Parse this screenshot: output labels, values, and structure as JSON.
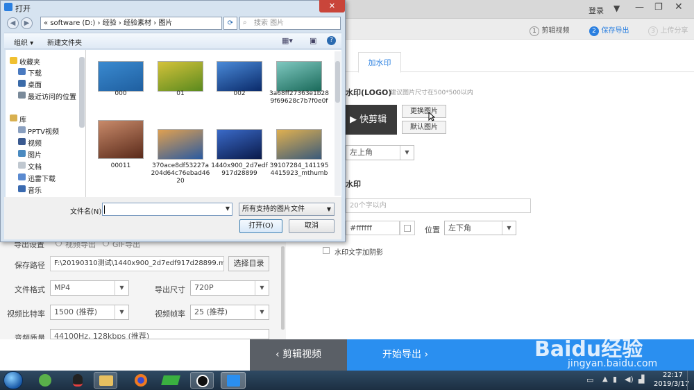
{
  "app": {
    "login": "登录",
    "steps": [
      {
        "num": "1",
        "label": "剪辑视频"
      },
      {
        "num": "2",
        "label": "保存导出"
      },
      {
        "num": "3",
        "label": "上传分享"
      }
    ],
    "tabs": {
      "watermark": "加水印"
    },
    "logo_section": {
      "title": "水印(LOGO)",
      "hint": "建议图片尺寸在500*500以内",
      "logo_text": "快剪辑",
      "change_btn": "更换图片",
      "default_btn": "默认图片",
      "position_value": "左上角"
    },
    "text_section": {
      "title": "水印",
      "placeholder": "20个字以内",
      "color_value": "#ffffff",
      "position_label": "位置",
      "position_value": "左下角",
      "shadow_label": "水印文字加阴影"
    },
    "export": {
      "settings_label": "导出设置",
      "mode_normal": "视频导出",
      "mode_gif": "GIF导出",
      "save_path_label": "保存路径",
      "save_path_value": "F:\\20190310测试\\1440x900_2d7edf917d28899.mp4",
      "choose_dir_btn": "选择目录",
      "format_label": "文件格式",
      "format_value": "MP4",
      "size_label": "导出尺寸",
      "size_value": "720P",
      "bitrate_label": "视频比特率",
      "bitrate_value": "1500 (推荐)",
      "fps_label": "视频帧率",
      "fps_value": "25 (推荐)",
      "audio_label": "音频质量",
      "audio_value": "44100Hz, 128kbps (推荐)"
    },
    "bottom": {
      "back_btn": "‹  剪辑视频",
      "start_btn": "开始导出  ›"
    }
  },
  "dialog": {
    "title": "打开",
    "breadcrumb": [
      "«",
      "software (D:)",
      "›",
      "经验",
      "›",
      "经验素材",
      "›",
      "图片"
    ],
    "search_placeholder": "搜索 图片",
    "organize": "组织 ▾",
    "new_folder": "新建文件夹",
    "nav": {
      "favorites": "收藏夹",
      "downloads": "下载",
      "desktop": "桌面",
      "recent": "最近访问的位置",
      "libraries": "库",
      "pptv": "PPTV视频",
      "videos": "视频",
      "pictures": "图片",
      "documents": "文档",
      "xunlei": "迅雷下载",
      "music": "音乐"
    },
    "files": [
      {
        "name": "000",
        "colors": [
          "#1f5fa0",
          "#3a8ad0"
        ]
      },
      {
        "name": "01",
        "colors": [
          "#5a8a1e",
          "#d4c23a"
        ]
      },
      {
        "name": "002",
        "colors": [
          "#0a2a6a",
          "#4a8ad8"
        ]
      },
      {
        "name": "3a68ff27363e1b289f69628c7b7f0e0f",
        "colors": [
          "#1a6a5a",
          "#7fc8c0"
        ]
      },
      {
        "name": "00011",
        "colors": [
          "#5a2a1a",
          "#c88a6a"
        ]
      },
      {
        "name": "370ace8df53227a204d64c76ebad4620",
        "colors": [
          "#2a5aa0",
          "#e0a050"
        ]
      },
      {
        "name": "1440x900_2d7edf917d28899",
        "colors": [
          "#0a1a4a",
          "#3a6ac8"
        ]
      },
      {
        "name": "39107284_1411954415923_mthumb",
        "colors": [
          "#3a5a7a",
          "#e0b050"
        ]
      }
    ],
    "filename_label": "文件名(N):",
    "filename_value": "",
    "filetype_value": "所有支持的图片文件",
    "open_btn": "打开(O)",
    "cancel_btn": "取消"
  },
  "taskbar": {
    "time": "22:17",
    "date": "2019/3/17"
  },
  "watermark_overlay": {
    "brand": "Baidu经验",
    "url": "jingyan.baidu.com"
  }
}
